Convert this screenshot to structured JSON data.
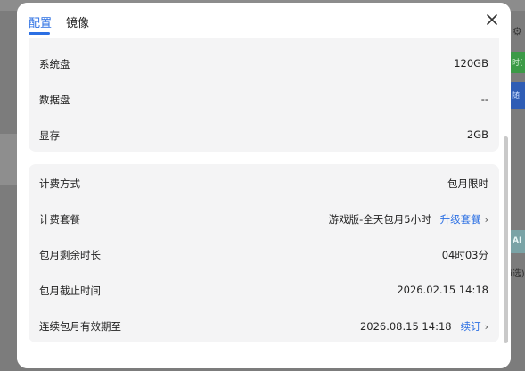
{
  "background": {
    "green_badge": "时(",
    "blue_badge": "随",
    "ai_badge": "AI",
    "side_text": "i选)"
  },
  "dialog": {
    "tabs": [
      {
        "label": "配置",
        "active": true
      },
      {
        "label": "镜像",
        "active": false
      }
    ],
    "close_icon": "close-icon",
    "accent_color": "#2b6fe3",
    "hardware": [
      {
        "label": "系统盘",
        "value": "120GB"
      },
      {
        "label": "数据盘",
        "value": "--"
      },
      {
        "label": "显存",
        "value": "2GB"
      }
    ],
    "billing": {
      "method_label": "计费方式",
      "method_value": "包月限时",
      "plan_label": "计费套餐",
      "plan_value": "游戏版-全天包月5小时",
      "plan_link": "升级套餐",
      "remaining_label": "包月剩余时长",
      "remaining_value": "04时03分",
      "deadline_label": "包月截止时间",
      "deadline_value": "2026.02.15 14:18",
      "renewal_label": "连续包月有效期至",
      "renewal_value": "2026.08.15 14:18",
      "renewal_link": "续订"
    }
  }
}
